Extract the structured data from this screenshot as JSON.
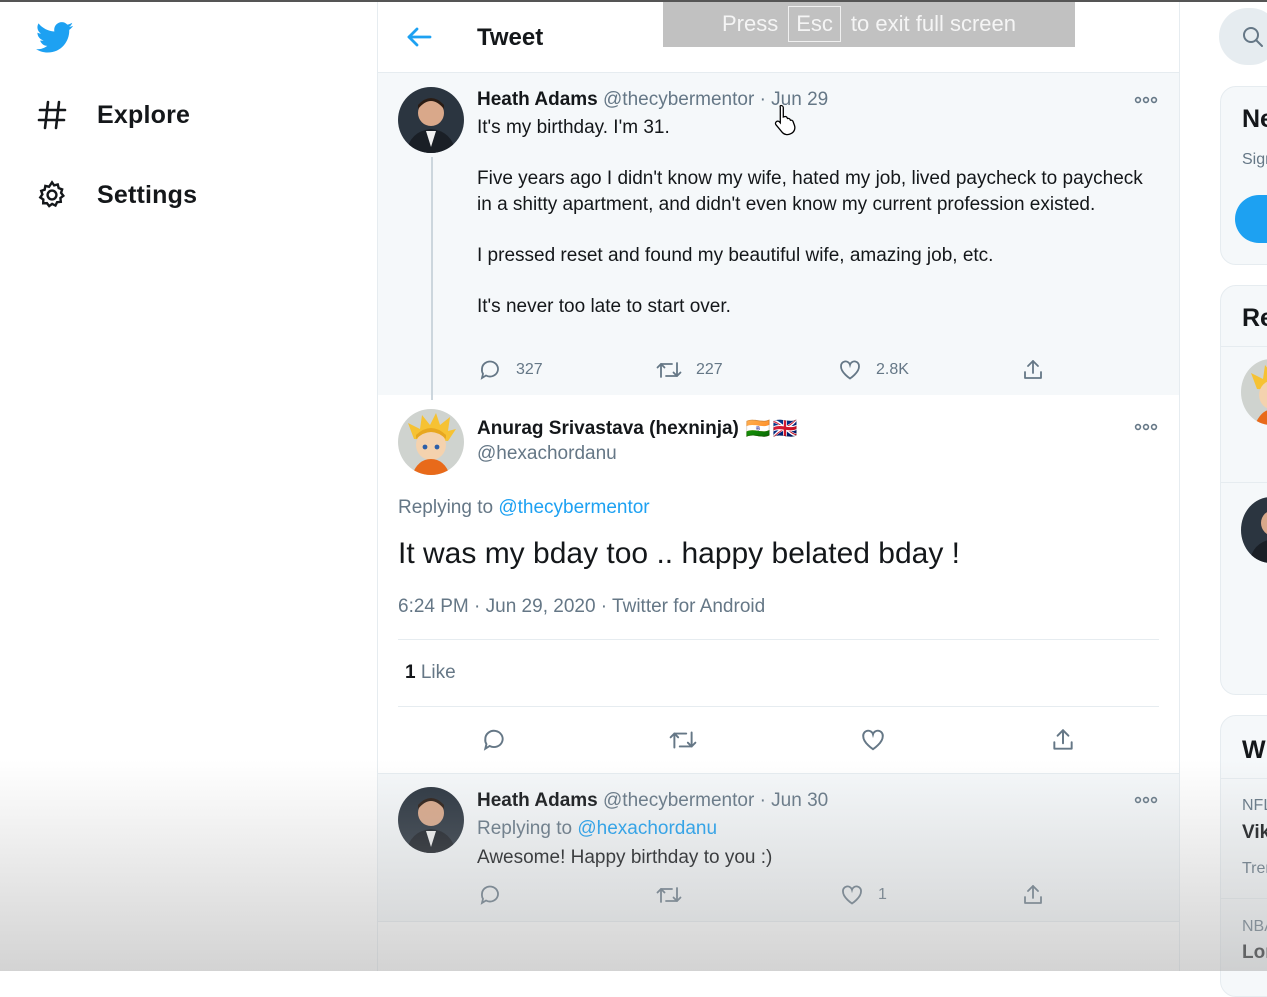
{
  "nav": {
    "logo": "twitter-bird-icon",
    "items": [
      {
        "label": "Explore",
        "icon": "hashtag-icon"
      },
      {
        "label": "Settings",
        "icon": "gear-icon"
      }
    ]
  },
  "header": {
    "title": "Tweet",
    "back_icon": "back-arrow-icon"
  },
  "fullscreen_banner": {
    "press": "Press",
    "key": "Esc",
    "rest": "to exit full screen"
  },
  "tweets": {
    "parent": {
      "name": "Heath Adams",
      "handle": "@thecybermentor",
      "date": "· Jun 29",
      "paragraphs": [
        "It's my birthday. I'm 31.",
        "Five years ago I didn't know my wife, hated my job, lived paycheck to paycheck in a shitty apartment, and didn't even know my current profession existed.",
        "I pressed reset and found my beautiful wife, amazing job, etc.",
        "It's never too late to start over."
      ],
      "replies": "327",
      "retweets": "227",
      "likes": "2.8K"
    },
    "main": {
      "name": "Anurag Srivastava (hexninja)",
      "flags": [
        "🇮🇳",
        "🇬🇧"
      ],
      "handle": "@hexachordanu",
      "replying_prefix": "Replying to",
      "replying_to": "@thecybermentor",
      "text": "It was my bday too .. happy belated bday !",
      "meta": "6:24 PM · Jun 29, 2020 · Twitter for Android",
      "like_count": "1",
      "like_label": "Like"
    },
    "reply": {
      "name": "Heath Adams",
      "handle": "@thecybermentor",
      "date": "· Jun 30",
      "replying_prefix": "Replying to",
      "replying_to": "@hexachordanu",
      "text": "Awesome!  Happy birthday to you :)",
      "likes": "1"
    }
  },
  "sidebar": {
    "card1_title": "Ne",
    "card1_sub": "Sign",
    "card2_title": "Re",
    "card3_title": "W",
    "trend1_cat": "NFL",
    "trend1_name": "Vik",
    "trend1_extra": "Tren",
    "trend2_cat": "NBA",
    "trend2_name": "Lor"
  },
  "colors": {
    "accent": "#1da1f2",
    "secondary_text": "#657786"
  }
}
